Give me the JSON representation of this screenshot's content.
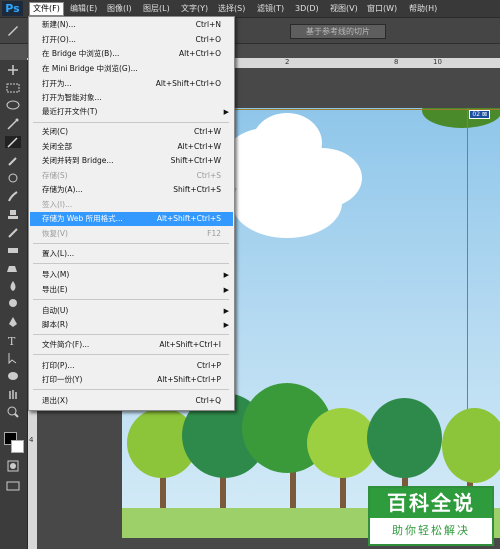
{
  "app": {
    "logo": "Ps"
  },
  "menubar": [
    {
      "label": "文件(F)"
    },
    {
      "label": "编辑(E)"
    },
    {
      "label": "图像(I)"
    },
    {
      "label": "图层(L)"
    },
    {
      "label": "文字(Y)"
    },
    {
      "label": "选择(S)"
    },
    {
      "label": "滤镜(T)"
    },
    {
      "label": "3D(D)"
    },
    {
      "label": "视图(V)"
    },
    {
      "label": "窗口(W)"
    },
    {
      "label": "帮助(H)"
    }
  ],
  "options": {
    "slice_button": "基于参考线的切片"
  },
  "rulers": {
    "top_2": "2",
    "top_8": "8",
    "top_10": "10",
    "left_4": "4"
  },
  "canvas": {
    "slice_tag": "02 ⊠"
  },
  "file_menu": [
    {
      "label": "新建(N)...",
      "shortcut": "Ctrl+N"
    },
    {
      "label": "打开(O)...",
      "shortcut": "Ctrl+O"
    },
    {
      "label": "在 Bridge 中浏览(B)...",
      "shortcut": "Alt+Ctrl+O"
    },
    {
      "label": "在 Mini Bridge 中浏览(G)...",
      "shortcut": ""
    },
    {
      "label": "打开为...",
      "shortcut": "Alt+Shift+Ctrl+O"
    },
    {
      "label": "打开为智能对象...",
      "shortcut": ""
    },
    {
      "label": "最近打开文件(T)",
      "shortcut": ""
    },
    {
      "label": "关闭(C)",
      "shortcut": "Ctrl+W"
    },
    {
      "label": "关闭全部",
      "shortcut": "Alt+Ctrl+W"
    },
    {
      "label": "关闭并转到 Bridge...",
      "shortcut": "Shift+Ctrl+W"
    },
    {
      "label": "存储(S)",
      "shortcut": "Ctrl+S"
    },
    {
      "label": "存储为(A)...",
      "shortcut": "Shift+Ctrl+S"
    },
    {
      "label": "签入(I)...",
      "shortcut": ""
    },
    {
      "label": "存储为 Web 所用格式...",
      "shortcut": "Alt+Shift+Ctrl+S"
    },
    {
      "label": "恢复(V)",
      "shortcut": "F12"
    },
    {
      "label": "置入(L)...",
      "shortcut": ""
    },
    {
      "label": "导入(M)",
      "shortcut": ""
    },
    {
      "label": "导出(E)",
      "shortcut": ""
    },
    {
      "label": "自动(U)",
      "shortcut": ""
    },
    {
      "label": "脚本(R)",
      "shortcut": ""
    },
    {
      "label": "文件简介(F)...",
      "shortcut": "Alt+Shift+Ctrl+I"
    },
    {
      "label": "打印(P)...",
      "shortcut": "Ctrl+P"
    },
    {
      "label": "打印一份(Y)",
      "shortcut": "Alt+Shift+Ctrl+P"
    },
    {
      "label": "退出(X)",
      "shortcut": "Ctrl+Q"
    }
  ],
  "watermark": {
    "title": "百科全说",
    "subtitle": "助你轻松解决"
  }
}
